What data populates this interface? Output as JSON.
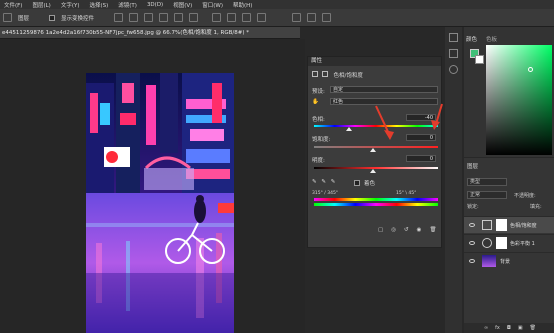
{
  "menubar": {
    "items": [
      "文件(F)",
      "图层(L)",
      "文字(Y)",
      "选择(S)",
      "滤镜(T)",
      "3D(D)",
      "视图(V)",
      "窗口(W)",
      "帮助(H)"
    ]
  },
  "optionsbar": {
    "label_left": "图层",
    "auto_select": "显示变换控件"
  },
  "document_tab": {
    "title": "e44511259876 1a2e4d2a16f730b55-NF7jpc_fw658.jpg @ 66.7%(色相/饱和度 1, RGB/8#) *"
  },
  "properties": {
    "tab_label": "属性",
    "panel_title": "色相/饱和度",
    "preset_label": "预设:",
    "preset_value": "自定",
    "channel_value": "红色",
    "hue_label": "色相:",
    "hue_value": "-40",
    "hue_fraction": 0.28,
    "saturation_label": "饱和度:",
    "saturation_value": "0",
    "lightness_label": "明度:",
    "lightness_value": "0",
    "colorize_label": "着色",
    "range_left": "315° / 345°",
    "range_right": "15° \\ 45°"
  },
  "color_panel": {
    "tab1": "颜色",
    "tab2": "色板"
  },
  "layers_panel": {
    "title": "图层",
    "kind_label": "类型",
    "blend_mode": "正常",
    "opacity_label": "不透明度:",
    "fill_label": "填充:",
    "lock_label": "锁定:",
    "layers": [
      {
        "name": "色相/饱和度"
      },
      {
        "name": "色彩平衡 1"
      },
      {
        "name": "背景"
      }
    ]
  },
  "colors": {
    "accent": "#2f6fb0",
    "swatch_green": "#3fbf77"
  }
}
